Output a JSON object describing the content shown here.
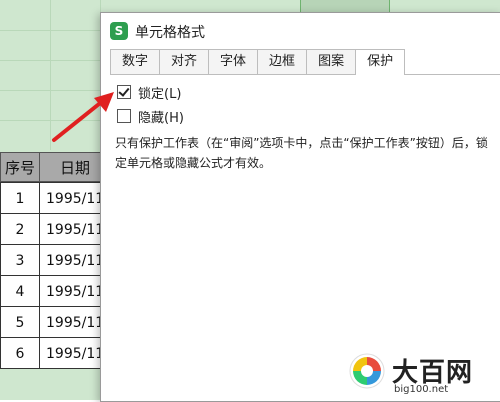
{
  "dialog": {
    "title": "单元格格式",
    "app_icon": "S",
    "tabs": [
      "数字",
      "对齐",
      "字体",
      "边框",
      "图案",
      "保护"
    ],
    "active_tab": "保护",
    "checkboxes": [
      {
        "label": "锁定(L)",
        "checked": true
      },
      {
        "label": "隐藏(H)",
        "checked": false
      }
    ],
    "description": [
      "只有保护工作表（在“审阅”选项卡中，点击“保护工作表”按钮）后，锁",
      "定单元格或隐藏公式才有效。"
    ]
  },
  "sheet": {
    "headers": [
      "序号",
      "日期"
    ],
    "rows": [
      [
        "1",
        "1995/11"
      ],
      [
        "2",
        "1995/11"
      ],
      [
        "3",
        "1995/11"
      ],
      [
        "4",
        "1995/11"
      ],
      [
        "5",
        "1995/11"
      ],
      [
        "6",
        "1995/11"
      ]
    ]
  },
  "watermark": {
    "text": "大百网",
    "url": "big100.net"
  },
  "colors": {
    "sheet_bg": "#cfe7cf",
    "header_bg": "#a9a9a9",
    "arrow": "#e02020",
    "app_icon": "#2e9e4f"
  }
}
